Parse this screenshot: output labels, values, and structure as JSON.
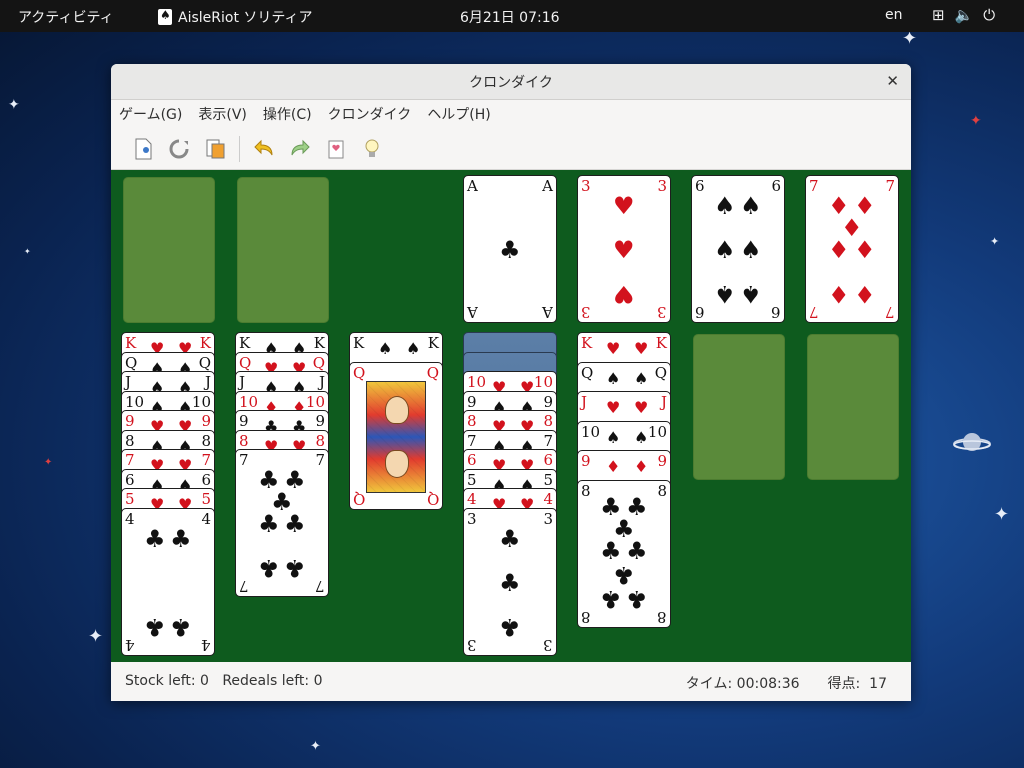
{
  "topbar": {
    "activities": "アクティビティ",
    "app_name": "AisleRiot ソリティア",
    "clock": "6月21日  07:16",
    "lang": "en"
  },
  "window": {
    "title": "クロンダイク"
  },
  "menu": [
    "ゲーム(G)",
    "表示(V)",
    "操作(C)",
    "クロンダイク",
    "ヘルプ(H)"
  ],
  "toolbar": {
    "new_icon": "new-game-icon",
    "restart_icon": "restart-icon",
    "select_icon": "select-game-icon",
    "undo_icon": "undo-icon",
    "redo_icon": "redo-icon",
    "deal_icon": "deal-icon",
    "hint_icon": "hint-icon"
  },
  "foundations": [
    {
      "rank": "A",
      "suit": "♣",
      "color": "black"
    },
    {
      "rank": "3",
      "suit": "♥",
      "color": "red"
    },
    {
      "rank": "6",
      "suit": "♠",
      "color": "black"
    },
    {
      "rank": "7",
      "suit": "♦",
      "color": "red"
    }
  ],
  "tableau": [
    {
      "cards": [
        "K♥",
        "Q♠",
        "J♠",
        "10♠",
        "9♥",
        "8♠",
        "7♥",
        "6♠",
        "5♥",
        "4♣"
      ]
    },
    {
      "cards": [
        "K♠",
        "Q♥",
        "J♠",
        "10♦",
        "9♣",
        "8♥",
        "7♣"
      ]
    },
    {
      "cards": [
        "K♠",
        "Q♥"
      ]
    },
    {
      "backs": 2,
      "cards": [
        "10♥",
        "9♠",
        "8♥",
        "7♠",
        "6♥",
        "5♠",
        "4♥",
        "3♣"
      ]
    },
    {
      "cards": [
        "K♥",
        "Q♠",
        "J♥",
        "10♠",
        "9♦",
        "8♣"
      ]
    },
    {
      "cards": []
    },
    {
      "cards": []
    }
  ],
  "status": {
    "stock_left": "Stock left: 0",
    "redeals_left": "Redeals left: 0",
    "time_label": "タイム:",
    "time_value": "00:08:36",
    "score_label": "得点:",
    "score_value": "17"
  }
}
